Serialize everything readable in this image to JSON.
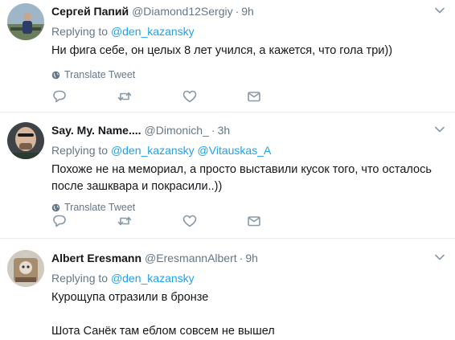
{
  "tweets": [
    {
      "name": "Сергей Папий",
      "handle": "@Diamond12Sergiy",
      "separator": "·",
      "time": "9h",
      "replying_prefix": "Replying to",
      "mentions": [
        "@den_kazansky"
      ],
      "text": "Ни фига себе, он целых 8 лет учился, а кажется, что гола три))",
      "translate_label": "Translate Tweet"
    },
    {
      "name": "Say. My. Name....",
      "handle": "@Dimonich_",
      "separator": "·",
      "time": "3h",
      "replying_prefix": "Replying to",
      "mentions": [
        "@den_kazansky",
        "@Vitauskas_A"
      ],
      "text": "Похоже не на мемориал, а просто выставили кусок того, что осталось после зашквара и покрасили..))",
      "translate_label": "Translate Tweet"
    },
    {
      "name": "Albert Eresmann",
      "handle": "@EresmannAlbert",
      "separator": "·",
      "time": "9h",
      "replying_prefix": "Replying to",
      "mentions": [
        "@den_kazansky"
      ],
      "text": "Курощупа отразили в бронзе\n\nШота Санёк там еблом совсем не вышел"
    }
  ],
  "icons": {
    "more": "chevron-down-icon",
    "globe": "globe-icon",
    "reply": "reply-icon",
    "retweet": "retweet-icon",
    "like": "heart-icon",
    "dm": "envelope-icon"
  },
  "colors": {
    "link": "#1da1f2",
    "muted": "#657786",
    "icon": "#8899a6",
    "divider": "#e6ecf0"
  }
}
